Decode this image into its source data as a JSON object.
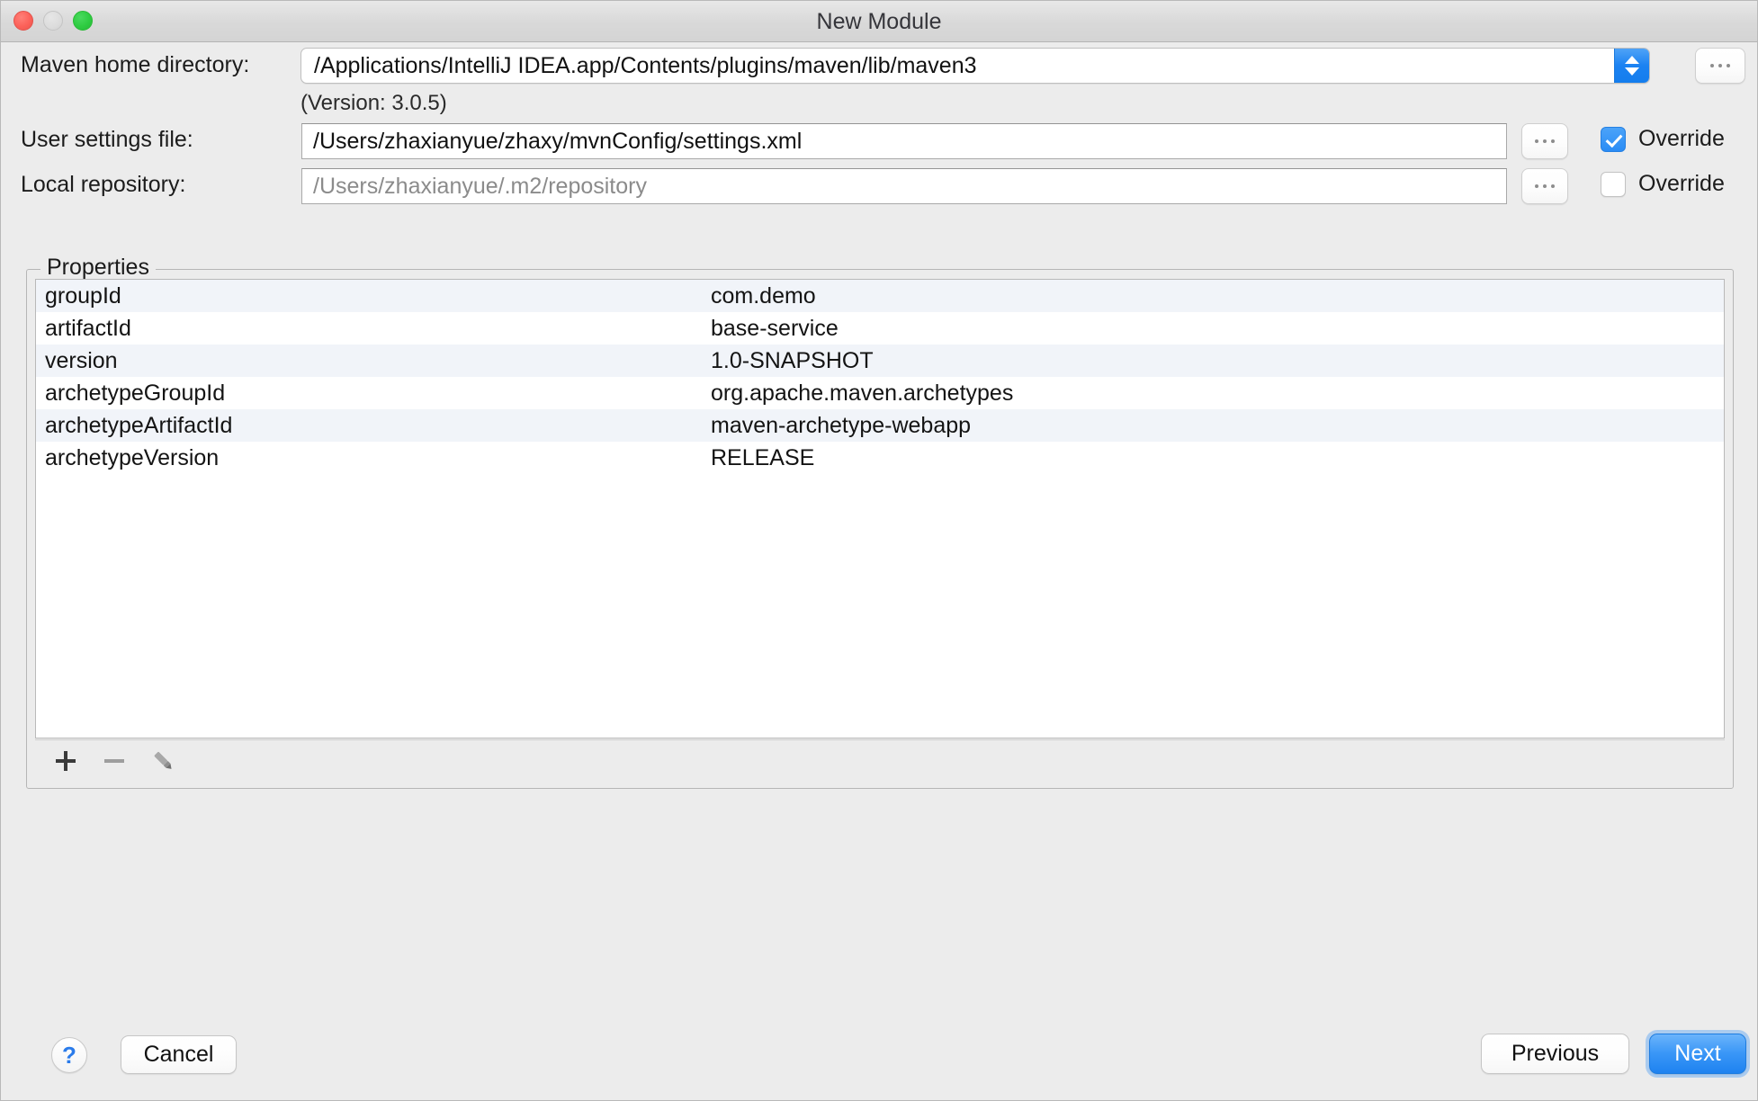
{
  "window": {
    "title": "New Module",
    "traffic_lights": [
      "close",
      "minimize",
      "maximize"
    ]
  },
  "form": {
    "maven_home": {
      "label": "Maven home directory:",
      "value": "/Applications/IntelliJ IDEA.app/Contents/plugins/maven/lib/maven3",
      "version_note": "(Version: 3.0.5)",
      "browse_label": "..."
    },
    "user_settings": {
      "label": "User settings file:",
      "value": "/Users/zhaxianyue/zhaxy/mvnConfig/settings.xml",
      "browse_label": "...",
      "override_label": "Override",
      "override_checked": true
    },
    "local_repository": {
      "label": "Local repository:",
      "value": "/Users/zhaxianyue/.m2/repository",
      "browse_label": "...",
      "override_label": "Override",
      "override_checked": false
    }
  },
  "properties": {
    "title": "Properties",
    "rows": [
      {
        "key": "groupId",
        "value": "com.demo"
      },
      {
        "key": "artifactId",
        "value": "base-service"
      },
      {
        "key": "version",
        "value": "1.0-SNAPSHOT"
      },
      {
        "key": "archetypeGroupId",
        "value": "org.apache.maven.archetypes"
      },
      {
        "key": "archetypeArtifactId",
        "value": "maven-archetype-webapp"
      },
      {
        "key": "archetypeVersion",
        "value": "RELEASE"
      }
    ],
    "toolbar": {
      "add": "add-icon",
      "remove": "remove-icon",
      "edit": "edit-pencil-icon"
    }
  },
  "footer": {
    "help_label": "?",
    "cancel_label": "Cancel",
    "previous_label": "Previous",
    "next_label": "Next"
  },
  "colors": {
    "accent": "#1e82f0",
    "window_bg": "#ececec",
    "row_alt": "#f1f4f9"
  }
}
